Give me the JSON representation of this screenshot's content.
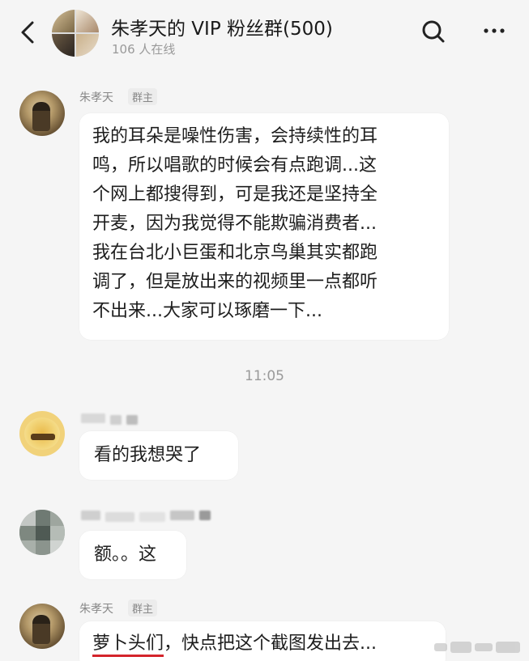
{
  "header": {
    "title": "朱孝天的 VIP 粉丝群(500)",
    "online": "106 人在线"
  },
  "messages": [
    {
      "sender": "朱孝天",
      "role": "群主",
      "text": "我的耳朵是噪性伤害，会持续性的耳\n鸣，所以唱歌的时候会有点跑调...这\n个网上都搜得到，可是我还是坚持全\n开麦，因为我觉得不能欺骗消费者...\n我在台北小巨蛋和北京鸟巢其实都跑\n调了，但是放出来的视频里一点都听\n不出来...大家可以琢磨一下..."
    },
    {
      "timestamp": "11:05"
    },
    {
      "sender": "",
      "text": "看的我想哭了"
    },
    {
      "sender": "",
      "text": "额。。这"
    },
    {
      "sender": "朱孝天",
      "role": "群主",
      "text_highlight": "萝卜头们",
      "text_rest": "，快点把这个截图发出去..."
    }
  ],
  "icons": {
    "back": "chevron-left-icon",
    "search": "search-icon",
    "more": "more-dots-icon"
  },
  "colors": {
    "background": "#f5f5f5",
    "bubble": "#ffffff",
    "underline": "#d4242b",
    "secondary_text": "#999999"
  }
}
